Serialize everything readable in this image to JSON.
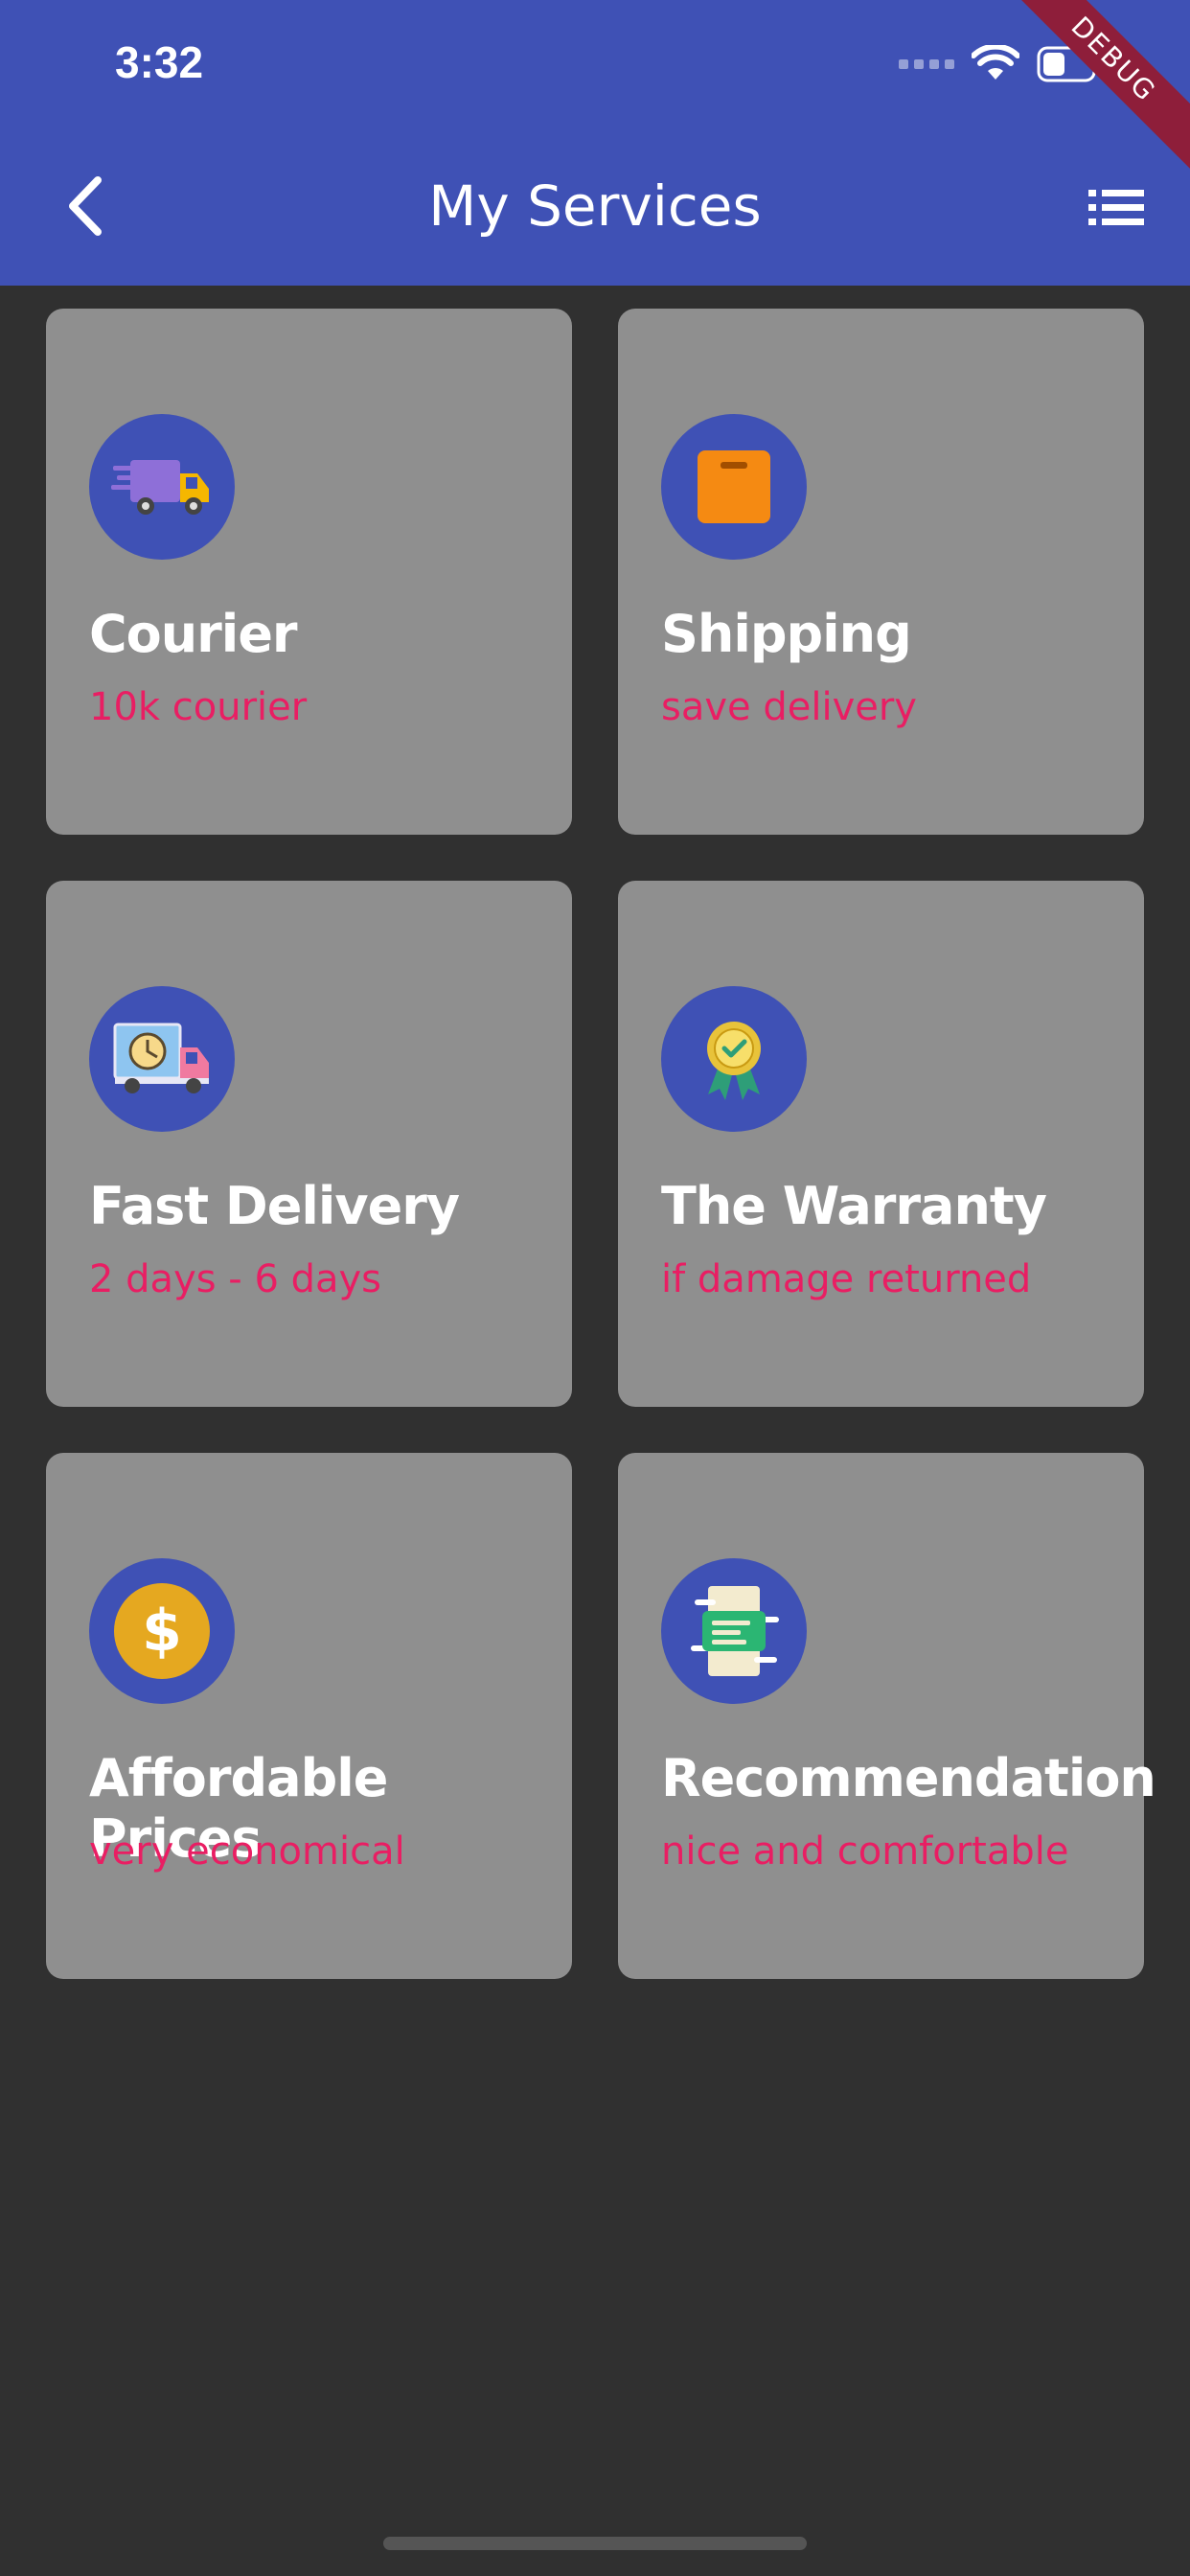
{
  "status_bar": {
    "time": "3:32"
  },
  "debug_banner": "DEBUG",
  "appbar": {
    "title": "My Services"
  },
  "services": [
    {
      "title": "Courier",
      "subtitle": "10k courier",
      "icon": "delivery-truck-icon"
    },
    {
      "title": "Shipping",
      "subtitle": "save delivery",
      "icon": "package-box-icon"
    },
    {
      "title": "Fast Delivery",
      "subtitle": "2 days - 6 days",
      "icon": "clock-truck-icon"
    },
    {
      "title": "The Warranty",
      "subtitle": "if damage returned",
      "icon": "award-badge-icon"
    },
    {
      "title": "Affordable Prices",
      "subtitle": "very economical",
      "icon": "dollar-coin-icon"
    },
    {
      "title": "Recommendation",
      "subtitle": "nice and comfortable",
      "icon": "message-card-icon"
    }
  ],
  "colors": {
    "primary": "#3F51B5",
    "background": "#303030",
    "card": "#8F8F8F",
    "subtitle": "#E91E63"
  }
}
